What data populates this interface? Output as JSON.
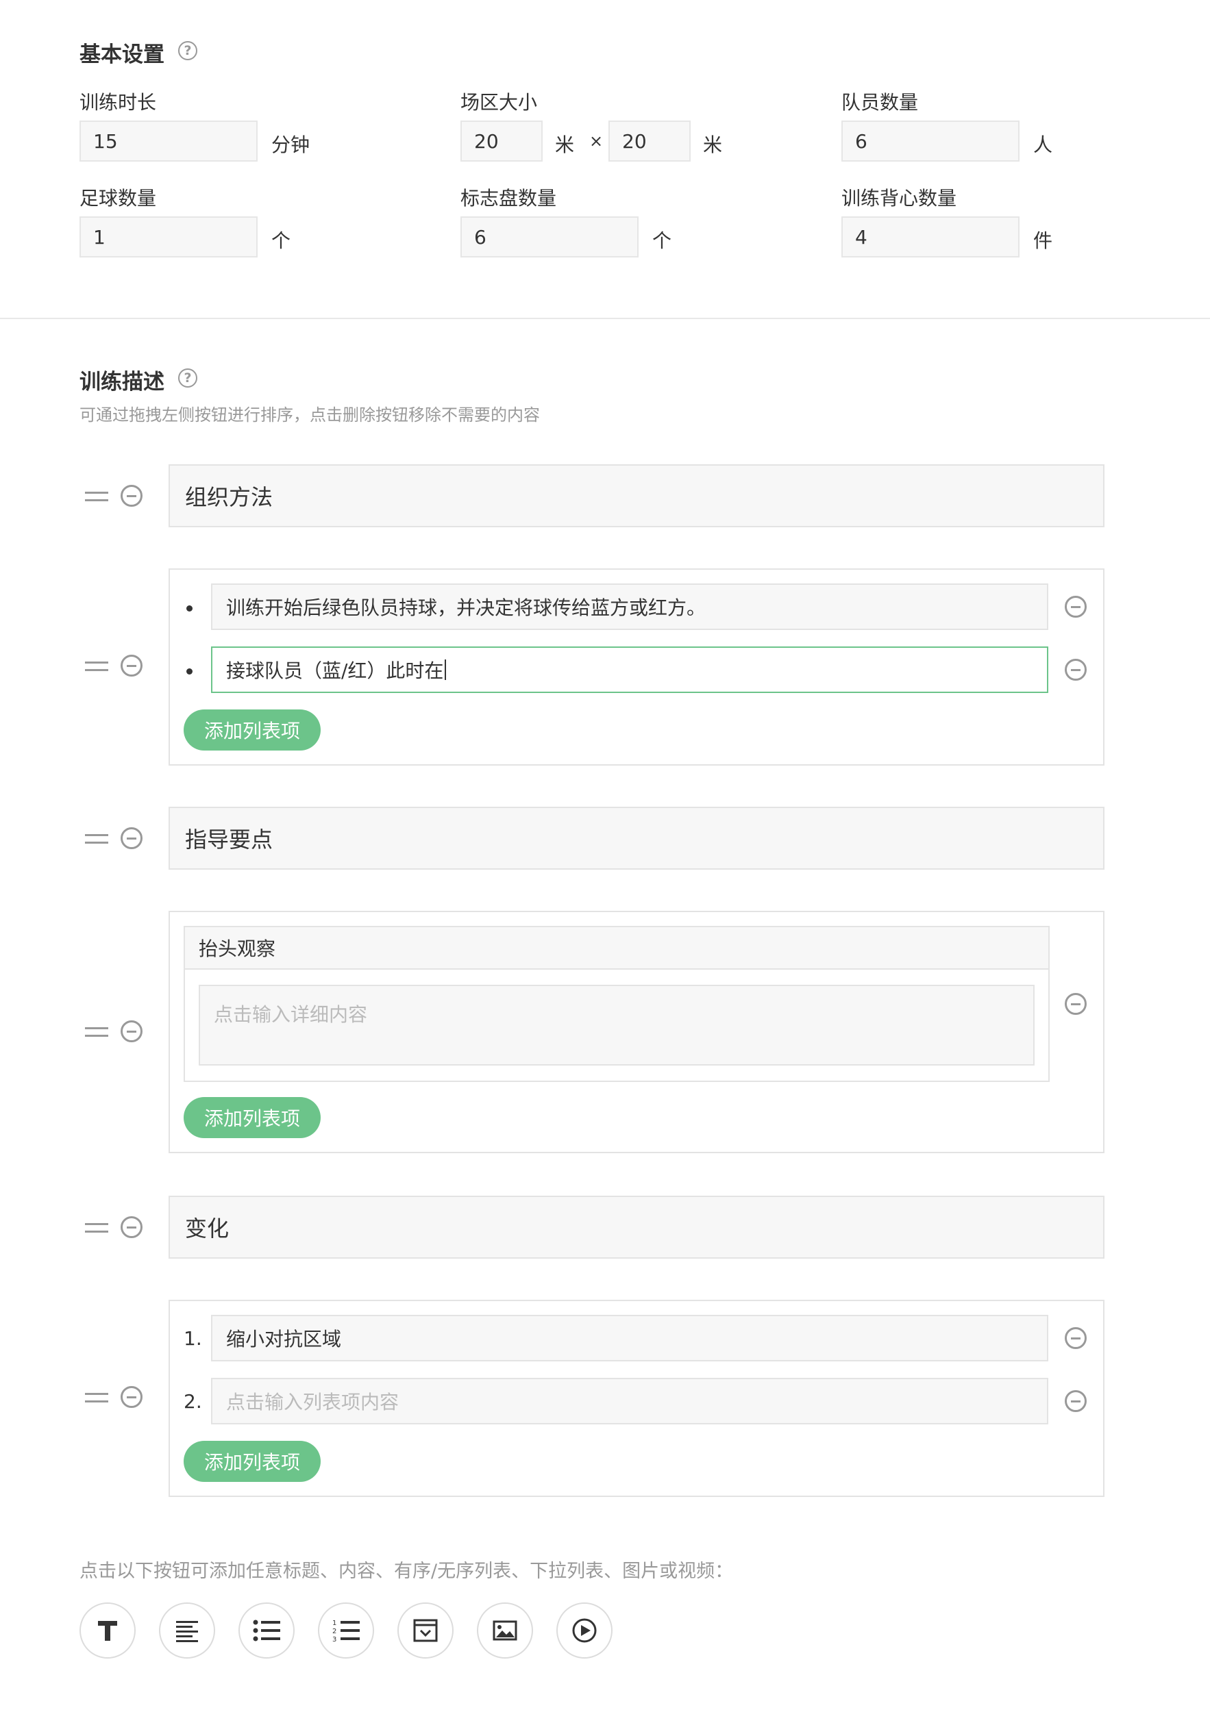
{
  "basic": {
    "title": "基本设置",
    "help_glyph": "?",
    "fields": {
      "duration": {
        "label": "训练时长",
        "value": "15",
        "unit": "分钟"
      },
      "field_size": {
        "label": "场区大小",
        "width": "20",
        "width_unit": "米",
        "times": "×",
        "length": "20",
        "length_unit": "米"
      },
      "players": {
        "label": "队员数量",
        "value": "6",
        "unit": "人"
      },
      "balls": {
        "label": "足球数量",
        "value": "1",
        "unit": "个"
      },
      "cones": {
        "label": "标志盘数量",
        "value": "6",
        "unit": "个"
      },
      "vests": {
        "label": "训练背心数量",
        "value": "4",
        "unit": "件"
      }
    }
  },
  "desc": {
    "title": "训练描述",
    "help_glyph": "?",
    "hint": "可通过拖拽左侧按钮进行排序，点击删除按钮移除不需要的内容",
    "block1_heading": "组织方法",
    "block2_items": [
      "训练开始后绿色队员持球，并决定将球传给蓝方或红方。",
      "接球队员（蓝/红）此时在"
    ],
    "add_item_label": "添加列表项",
    "block3_heading": "指导要点",
    "block4_title": "抬头观察",
    "block4_placeholder": "点击输入详细内容",
    "block5_heading": "变化",
    "block6_numbers": [
      "1.",
      "2."
    ],
    "block6_item1": "缩小对抗区域",
    "block6_item2_placeholder": "点击输入列表项内容"
  },
  "toolbar": {
    "hint": "点击以下按钮可添加任意标题、内容、有序/无序列表、下拉列表、图片或视频：",
    "icons": [
      "title-icon",
      "paragraph-icon",
      "unordered-list-icon",
      "ordered-list-icon",
      "dropdown-list-icon",
      "image-icon",
      "video-icon"
    ]
  },
  "colors": {
    "accent": "#6cc48a",
    "input_bg": "#f7f7f7",
    "border": "#e3e3e3",
    "muted": "#999999"
  }
}
